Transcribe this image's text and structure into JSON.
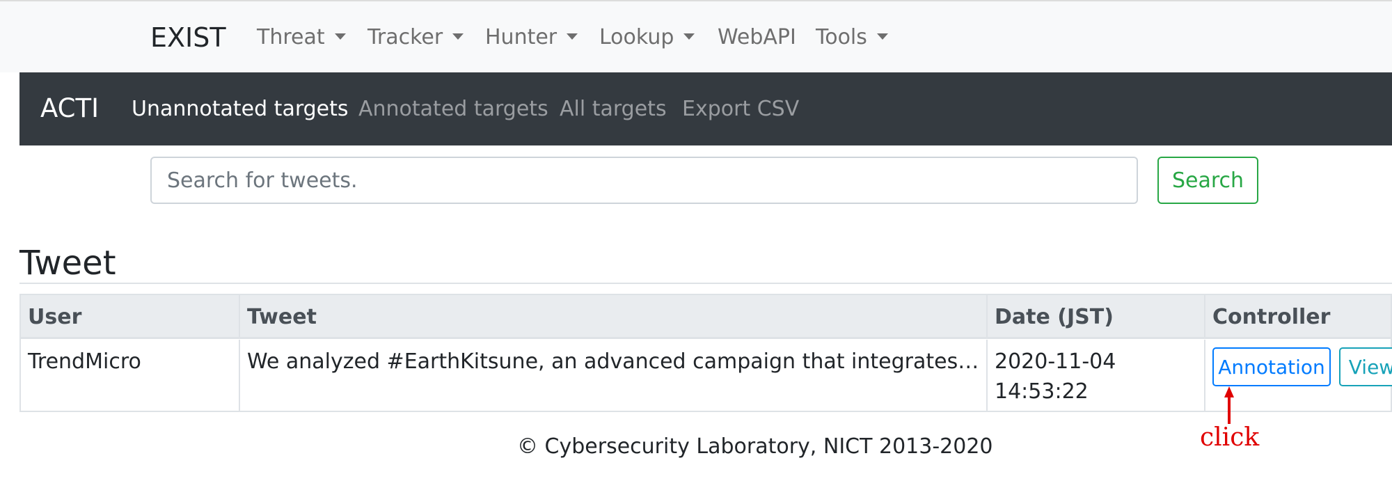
{
  "top_nav": {
    "brand": "EXIST",
    "items": [
      {
        "label": "Threat",
        "dropdown": true
      },
      {
        "label": "Tracker",
        "dropdown": true
      },
      {
        "label": "Hunter",
        "dropdown": true
      },
      {
        "label": "Lookup",
        "dropdown": true
      },
      {
        "label": "WebAPI",
        "dropdown": false
      },
      {
        "label": "Tools",
        "dropdown": true
      }
    ]
  },
  "sub_nav": {
    "brand": "ACTI",
    "items": [
      {
        "label": "Unannotated targets",
        "active": true
      },
      {
        "label": "Annotated targets",
        "active": false
      },
      {
        "label": "All targets",
        "active": false
      },
      {
        "label": "Export CSV",
        "active": false
      }
    ]
  },
  "search": {
    "placeholder": "Search for tweets.",
    "value": "",
    "button_label": "Search"
  },
  "page_title": "Tweet",
  "table": {
    "columns": [
      "User",
      "Tweet",
      "Date (JST)",
      "Controller"
    ],
    "rows": [
      {
        "user": "TrendMicro",
        "tweet": "We analyzed #EarthKitsune, an advanced campaign that integrates …",
        "date_line1": "2020-11-04",
        "date_line2": "14:53:22",
        "annotation_label": "Annotation",
        "view_label": "View"
      }
    ]
  },
  "footer": {
    "text": "© Cybersecurity Laboratory, NICT 2013-2020"
  },
  "overlay": {
    "click_label": "click",
    "color": "#e00000"
  },
  "colors": {
    "navbar_light": "#f8f9fa",
    "navbar_dark": "#343a40",
    "success": "#28a745",
    "primary": "#007bff",
    "info": "#17a2b8"
  }
}
